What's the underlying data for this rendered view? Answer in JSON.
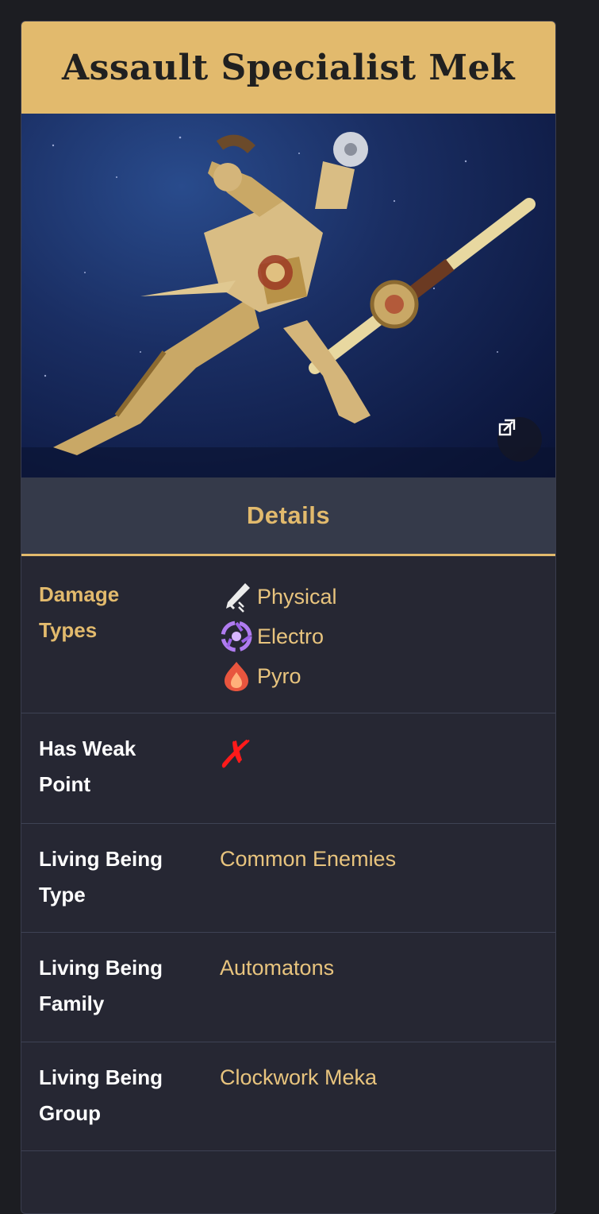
{
  "infobox": {
    "title": "Assault Specialist Mek",
    "image_alt": "Assault Specialist Mek render",
    "expand_icon": "expand-icon",
    "section_title": "Details",
    "damage_types": {
      "label": "Damage Types",
      "items": [
        {
          "name": "Physical",
          "icon": "physical-icon",
          "color": "#e9e9e9"
        },
        {
          "name": "Electro",
          "icon": "electro-icon",
          "color": "#b07cf0"
        },
        {
          "name": "Pyro",
          "icon": "pyro-icon",
          "color": "#e8553e"
        }
      ]
    },
    "weak_point": {
      "label": "Has Weak Point",
      "value": "✗"
    },
    "living_being_type": {
      "label": "Living Being Type",
      "value": "Common Enemies"
    },
    "living_being_family": {
      "label": "Living Being Family",
      "value": "Automatons"
    },
    "living_being_group": {
      "label": "Living Being Group",
      "value": "Clockwork Meka"
    }
  },
  "colors": {
    "accent": "#e2ba6d",
    "panel": "#262733",
    "section_header": "#353a4a",
    "negative": "#ff1a1a"
  }
}
